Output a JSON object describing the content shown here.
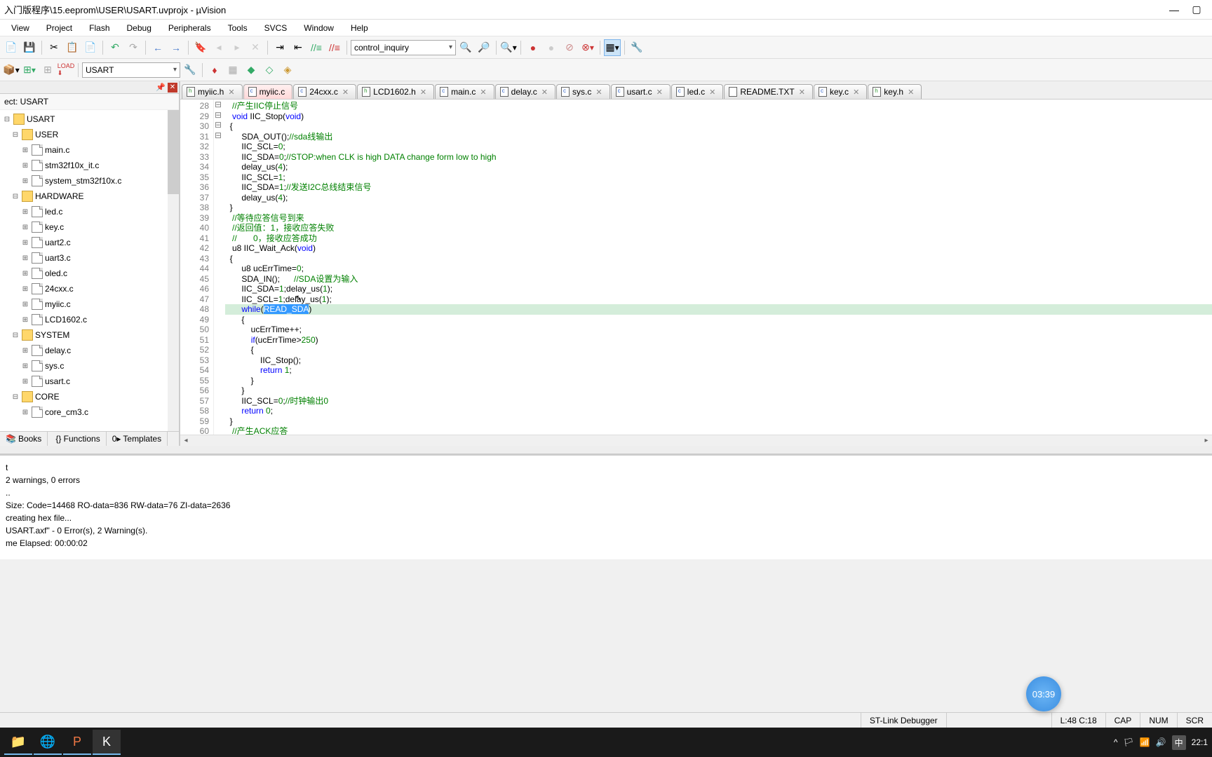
{
  "window": {
    "title": "入门版程序\\15.eeprom\\USER\\USART.uvprojx - µVision",
    "min": "—",
    "max": "▢"
  },
  "menu": [
    "View",
    "Project",
    "Flash",
    "Debug",
    "Peripherals",
    "Tools",
    "SVCS",
    "Window",
    "Help"
  ],
  "combo1": "control_inquiry",
  "combo2": "USART",
  "project_label": "ect: USART",
  "tree_root": "USART",
  "tree": [
    {
      "t": "g",
      "l": "USER"
    },
    {
      "t": "f",
      "l": "main.c"
    },
    {
      "t": "f",
      "l": "stm32f10x_it.c"
    },
    {
      "t": "f",
      "l": "system_stm32f10x.c"
    },
    {
      "t": "g",
      "l": "HARDWARE"
    },
    {
      "t": "f",
      "l": "led.c"
    },
    {
      "t": "f",
      "l": "key.c"
    },
    {
      "t": "f",
      "l": "uart2.c"
    },
    {
      "t": "f",
      "l": "uart3.c"
    },
    {
      "t": "f",
      "l": "oled.c"
    },
    {
      "t": "f",
      "l": "24cxx.c"
    },
    {
      "t": "f",
      "l": "myiic.c"
    },
    {
      "t": "f",
      "l": "LCD1602.c"
    },
    {
      "t": "g",
      "l": "SYSTEM"
    },
    {
      "t": "f",
      "l": "delay.c"
    },
    {
      "t": "f",
      "l": "sys.c"
    },
    {
      "t": "f",
      "l": "usart.c"
    },
    {
      "t": "g",
      "l": "CORE"
    },
    {
      "t": "f",
      "l": "core_cm3.c"
    }
  ],
  "side_tabs": [
    {
      "l": "Books",
      "ic": "📚"
    },
    {
      "l": "{} Functions",
      "ic": ""
    },
    {
      "l": "Templates",
      "ic": "0▸"
    }
  ],
  "file_tabs": [
    {
      "l": "myiic.h",
      "k": "h"
    },
    {
      "l": "myiic.c",
      "k": "c",
      "active": true
    },
    {
      "l": "24cxx.c",
      "k": "c"
    },
    {
      "l": "LCD1602.h",
      "k": "h"
    },
    {
      "l": "main.c",
      "k": "c"
    },
    {
      "l": "delay.c",
      "k": "c"
    },
    {
      "l": "sys.c",
      "k": "c"
    },
    {
      "l": "usart.c",
      "k": "c"
    },
    {
      "l": "led.c",
      "k": "c"
    },
    {
      "l": "README.TXT",
      "k": "txt"
    },
    {
      "l": "key.c",
      "k": "c"
    },
    {
      "l": "key.h",
      "k": "h"
    }
  ],
  "code_start": 28,
  "code_end": 60,
  "fold": {
    "30": "⊟",
    "43": "⊟",
    "49": "⊟",
    "52": "⊟"
  },
  "code_lines": [
    "   <span class='cm'>//产生IIC停止信号</span>",
    "   <span class='kw'>void</span> IIC_Stop(<span class='kw'>void</span>)",
    "  {",
    "       SDA_OUT();<span class='cm'>//sda线输出</span>",
    "       IIC_SCL=<span class='num'>0</span>;",
    "       IIC_SDA=<span class='num'>0</span>;<span class='cm'>//STOP:when CLK is high DATA change form low to high</span>",
    "       delay_us(<span class='num'>4</span>);",
    "       IIC_SCL=<span class='num'>1</span>;",
    "       IIC_SDA=<span class='num'>1</span>;<span class='cm'>//发送I2C总线结束信号</span>",
    "       delay_us(<span class='num'>4</span>);",
    "  }",
    "   <span class='cm'>//等待应答信号到来</span>",
    "   <span class='cm'>//返回值：1，接收应答失败</span>",
    "   <span class='cm'>//       0，接收应答成功</span>",
    "   u8 IIC_Wait_Ack(<span class='kw'>void</span>)",
    "  {",
    "       u8 ucErrTime=<span class='num'>0</span>;",
    "       SDA_IN();      <span class='cm'>//SDA设置为输入</span>",
    "       IIC_SDA=<span class='num'>1</span>;delay_us(<span class='num'>1</span>);",
    "       IIC_SCL=<span class='num'>1</span>;del<span style='position:relative'>a<span style='position:absolute;left:-2px;top:-2px;color:#000'>↖</span></span>y_us(<span class='num'>1</span>);",
    "       <span class='kw'>while</span>(<span class='sel'>READ_SDA</span>)",
    "       {",
    "           ucErrTime++;",
    "           <span class='kw'>if</span>(ucErrTime><span class='num'>250</span>)",
    "           {",
    "               IIC_Stop();",
    "               <span class='kw'>return</span> <span class='num'>1</span>;",
    "           }",
    "       }",
    "       IIC_SCL=<span class='num'>0</span>;<span class='cm'>//时钟输出0</span>",
    "       <span class='kw'>return</span> <span class='num'>0</span>;",
    "  }",
    "   <span class='cm'>//产生ACK应答</span>"
  ],
  "highlight_line": 48,
  "output": [
    "t",
    " 2 warnings, 0 errors",
    "..",
    " Size: Code=14468 RO-data=836 RW-data=76 ZI-data=2636",
    "  creating hex file...",
    " USART.axf\" - 0 Error(s), 2 Warning(s).",
    "me Elapsed:  00:00:02"
  ],
  "status": {
    "debugger": "ST-Link Debugger",
    "pos": "L:48 C:18",
    "caps": "CAP",
    "num": "NUM",
    "scr": "SCR"
  },
  "timer": "03:39",
  "tray": {
    "ime": "中",
    "time": "22:1"
  }
}
